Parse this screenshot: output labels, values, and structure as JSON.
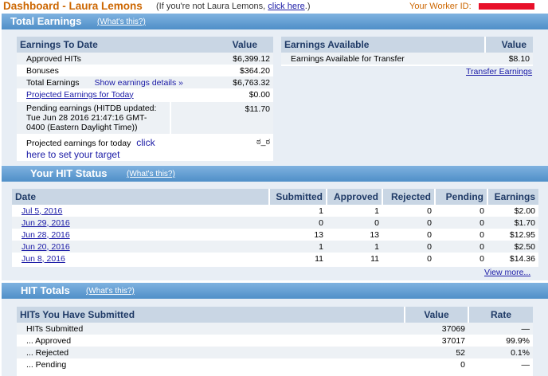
{
  "header": {
    "title": "Dashboard - Laura Lemons",
    "not_user_prefix": "(If you're not Laura Lemons, ",
    "click_here": "click here",
    "not_user_suffix": ".)",
    "worker_id_label": "Your Worker ID:"
  },
  "total_earnings": {
    "title": "Total Earnings",
    "help": "(What's this?)",
    "to_date": {
      "col_label": "Earnings To Date",
      "col_value": "Value",
      "approved_label": "Approved HITs",
      "approved_value": "$6,399.12",
      "bonuses_label": "Bonuses",
      "bonuses_value": "$364.20",
      "total_label": "Total Earnings",
      "show_details": "Show earnings details",
      "total_value": "$6,763.32",
      "projected_label": "Projected Earnings for Today",
      "projected_value": "$0.00",
      "pending_label_1": "Pending earnings (HITDB updated:",
      "pending_label_2": "Tue Jun 28 2016 21:47:16 GMT-",
      "pending_label_3": "0400 (Eastern Daylight Time))",
      "pending_value": "$11.70",
      "target_label": "Projected earnings for today",
      "target_link_1": "click",
      "target_link_2": "here to set your target",
      "target_value": "ಠ_ಠ"
    },
    "available": {
      "col_label": "Earnings Available",
      "col_value": "Value",
      "transfer_label": "Earnings Available for Transfer",
      "transfer_value": "$8.10",
      "transfer_link": "Transfer Earnings"
    }
  },
  "hit_status": {
    "title": "Your HIT Status",
    "help": "(What's this?)",
    "columns": [
      "Date",
      "Submitted",
      "Approved",
      "Rejected",
      "Pending",
      "Earnings"
    ],
    "rows": [
      {
        "date": "Jul 5, 2016",
        "submitted": "1",
        "approved": "1",
        "rejected": "0",
        "pending": "0",
        "earnings": "$2.00"
      },
      {
        "date": "Jun 29, 2016",
        "submitted": "0",
        "approved": "0",
        "rejected": "0",
        "pending": "0",
        "earnings": "$1.70"
      },
      {
        "date": "Jun 28, 2016",
        "submitted": "13",
        "approved": "13",
        "rejected": "0",
        "pending": "0",
        "earnings": "$12.95"
      },
      {
        "date": "Jun 20, 2016",
        "submitted": "1",
        "approved": "1",
        "rejected": "0",
        "pending": "0",
        "earnings": "$2.50"
      },
      {
        "date": "Jun 8, 2016",
        "submitted": "11",
        "approved": "11",
        "rejected": "0",
        "pending": "0",
        "earnings": "$14.36"
      }
    ],
    "view_more": "View more..."
  },
  "hit_totals": {
    "title": "HIT Totals",
    "help": "(What's this?)",
    "col_label": "HITs You Have Submitted",
    "col_value": "Value",
    "col_rate": "Rate",
    "rows": [
      {
        "label": "HITs Submitted",
        "value": "37069",
        "rate": "—"
      },
      {
        "label": "... Approved",
        "value": "37017",
        "rate": "99.9%"
      },
      {
        "label": "... Rejected",
        "value": "52",
        "rate": "0.1%"
      },
      {
        "label": "... Pending",
        "value": "0",
        "rate": "—"
      }
    ]
  },
  "colors": {
    "title_orange": "#cc6600",
    "section_blue": "#5b9bd5",
    "header_cell": "#c9d6e4",
    "panel_bg": "#e8eef5",
    "link_blue": "#1a1aa6",
    "redaction_red": "#e8102a"
  }
}
